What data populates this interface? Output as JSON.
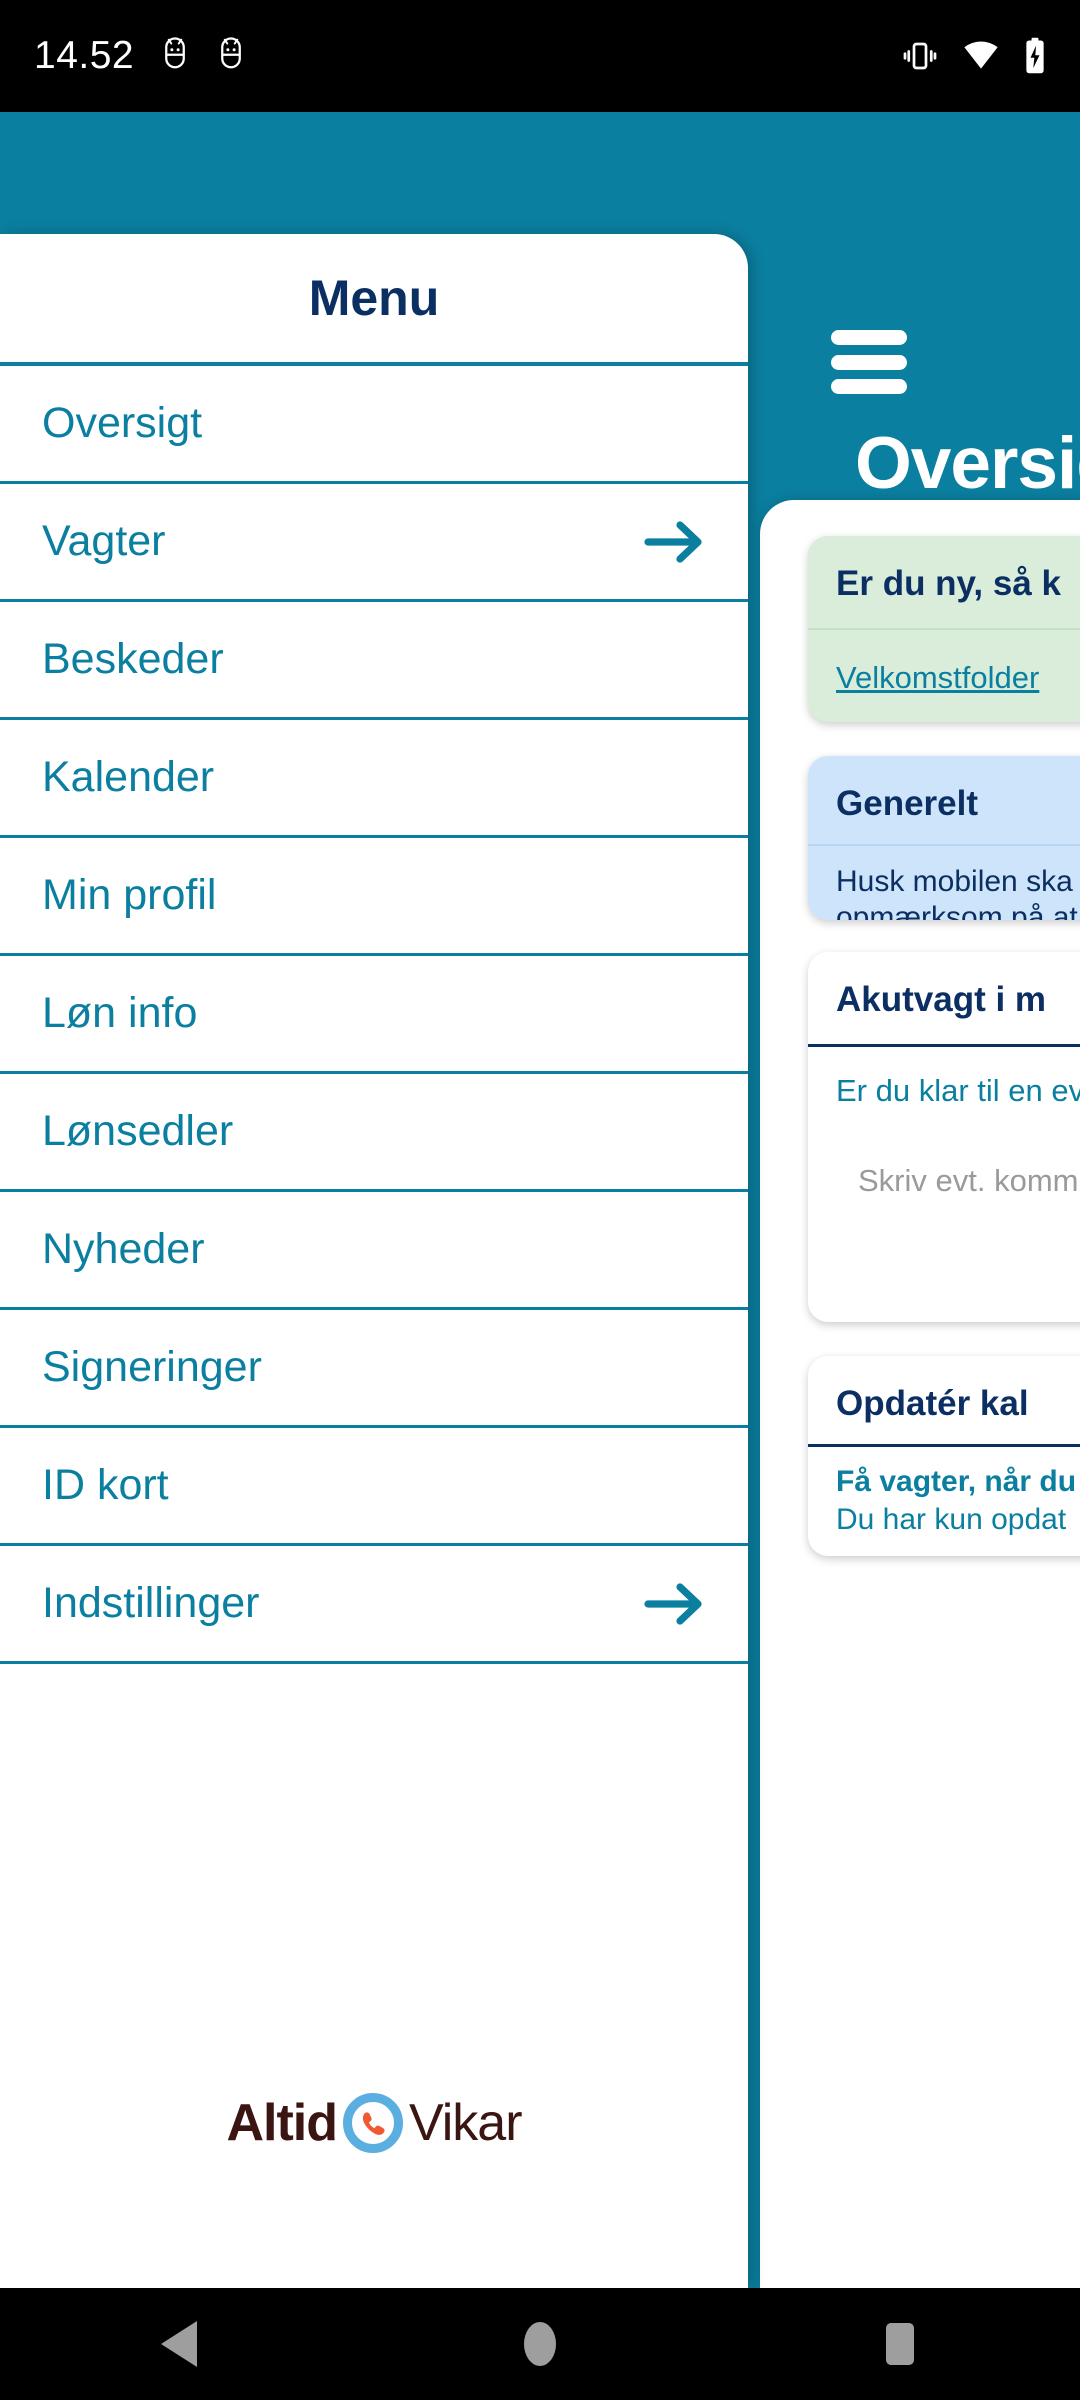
{
  "status_bar": {
    "time": "14.52",
    "left_icons": [
      "android-bug-icon",
      "android-bug-icon"
    ],
    "right_icons": [
      "vibrate-icon",
      "wifi-icon",
      "battery-charging-icon"
    ]
  },
  "colors": {
    "brand_teal": "#0b7fa0",
    "brand_navy": "#0b2f63",
    "card_green": "#d9edda",
    "card_blue": "#cde4fa",
    "logo_dark": "#3a1512",
    "logo_circle": "#5aaee0",
    "logo_phone": "#f05a32"
  },
  "drawer": {
    "title": "Menu",
    "items": [
      {
        "label": "Oversigt",
        "has_arrow": false
      },
      {
        "label": "Vagter",
        "has_arrow": true
      },
      {
        "label": "Beskeder",
        "has_arrow": false
      },
      {
        "label": "Kalender",
        "has_arrow": false
      },
      {
        "label": "Min profil",
        "has_arrow": false
      },
      {
        "label": "Løn info",
        "has_arrow": false
      },
      {
        "label": "Lønsedler",
        "has_arrow": false
      },
      {
        "label": "Nyheder",
        "has_arrow": false
      },
      {
        "label": "Signeringer",
        "has_arrow": false
      },
      {
        "label": "ID kort",
        "has_arrow": false
      },
      {
        "label": "Indstillinger",
        "has_arrow": true
      }
    ],
    "logo": {
      "word_1": "Altid",
      "word_2": "Vikar",
      "mark": "phone-in-circle-icon"
    }
  },
  "main": {
    "menu_button": "hamburger-icon",
    "page_title": "Oversigt",
    "cards": [
      {
        "id": "welcome",
        "title": "Er du ny, så k",
        "link": "Velkomstfolder"
      },
      {
        "id": "generelt",
        "title": "Generelt",
        "body": "Husk mobilen ska\nopmærksom på at"
      },
      {
        "id": "akutvagt",
        "title": "Akutvagt i m",
        "question": "Er du klar til en ev",
        "comment_placeholder": "Skriv evt. komm"
      },
      {
        "id": "opdater-kalender",
        "title": "Opdatér kal",
        "line_1": "Få vagter, når du g",
        "line_2": "Du har kun opdat"
      }
    ]
  },
  "nav_bar": {
    "back": "back-triangle-icon",
    "home": "home-circle-icon",
    "recents": "recents-square-icon"
  }
}
